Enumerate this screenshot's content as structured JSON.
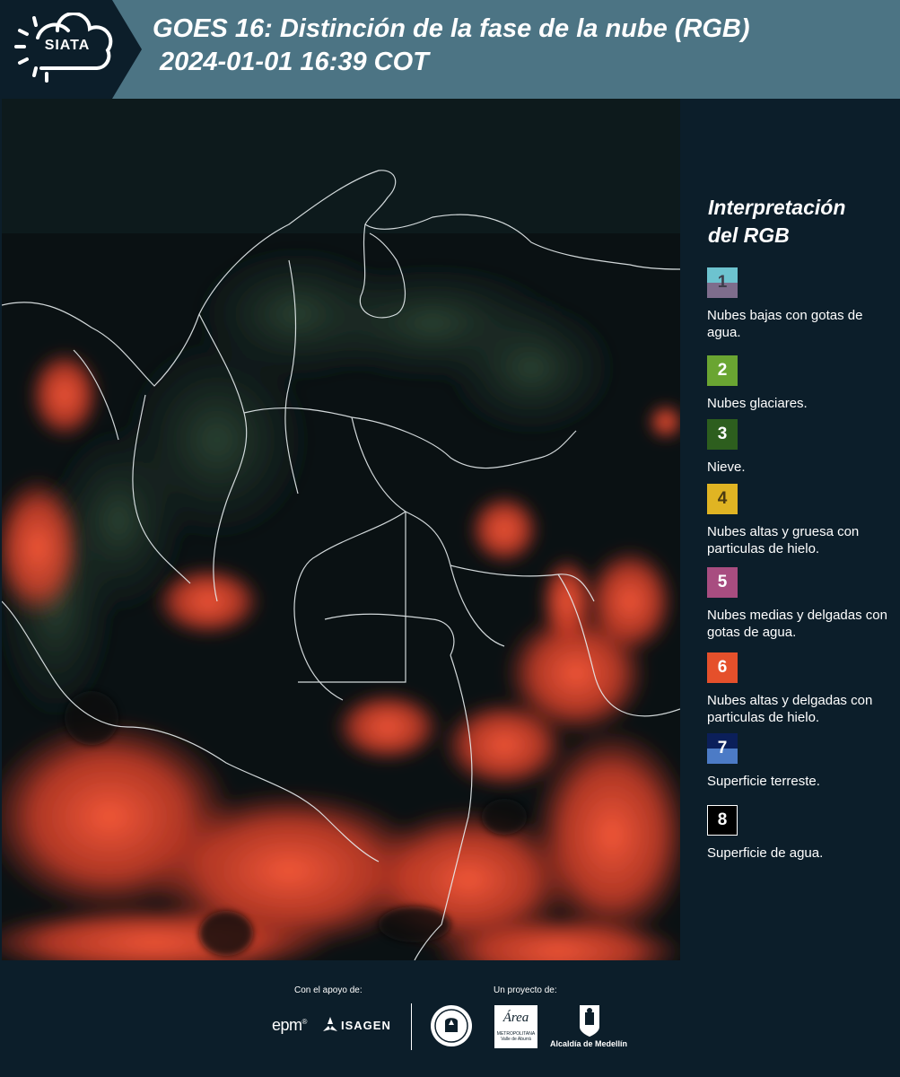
{
  "header": {
    "logo_text": "SIATA",
    "title_line1": "GOES 16: Distinción de la fase de la nube (RGB)",
    "title_line2": "2024-01-01 16:39 COT"
  },
  "legend": {
    "title_line1": "Interpretación",
    "title_line2": "del RGB",
    "items": [
      {
        "number": "1",
        "label": "Nubes bajas con gotas de agua.",
        "color_top": "#6dc3cf",
        "color_bottom": "#7e6d8c",
        "text_color": "#3d3d4a"
      },
      {
        "number": "2",
        "label": "Nubes glaciares.",
        "color_top": "#6aa532",
        "color_bottom": "#6aa532",
        "text_color": "#ffffff"
      },
      {
        "number": "3",
        "label": "Nieve.",
        "color_top": "#2d5e1e",
        "color_bottom": "#2d5e1e",
        "text_color": "#ffffff"
      },
      {
        "number": "4",
        "label": "Nubes altas y gruesa con particulas de hielo.",
        "color_top": "#e0b423",
        "color_bottom": "#e0b423",
        "text_color": "#4a3a12"
      },
      {
        "number": "5",
        "label": "Nubes medias y delgadas con gotas de agua.",
        "color_top": "#a84d80",
        "color_bottom": "#a84d80",
        "text_color": "#ffffff"
      },
      {
        "number": "6",
        "label": "Nubes altas y delgadas con particulas de hielo.",
        "color_top": "#e5502b",
        "color_bottom": "#e5502b",
        "text_color": "#ffffff"
      },
      {
        "number": "7",
        "label": "Superficie terreste.",
        "color_top": "#0b1f5a",
        "color_bottom": "#4c7bc6",
        "text_color": "#ffffff"
      },
      {
        "number": "8",
        "label": "Superficie de agua.",
        "color_top": "#000000",
        "color_bottom": "#000000",
        "text_color": "#ffffff"
      }
    ]
  },
  "footer": {
    "support_label": "Con el apoyo de:",
    "project_label": "Un proyecto de:",
    "epm_text": "epm",
    "isagen_text": "ISAGEN",
    "area_text": "Área",
    "area_sub1": "METROPOLITANA",
    "area_sub2": "Valle de Aburrá",
    "alcaldia_text": "Alcaldía de Medellín"
  }
}
